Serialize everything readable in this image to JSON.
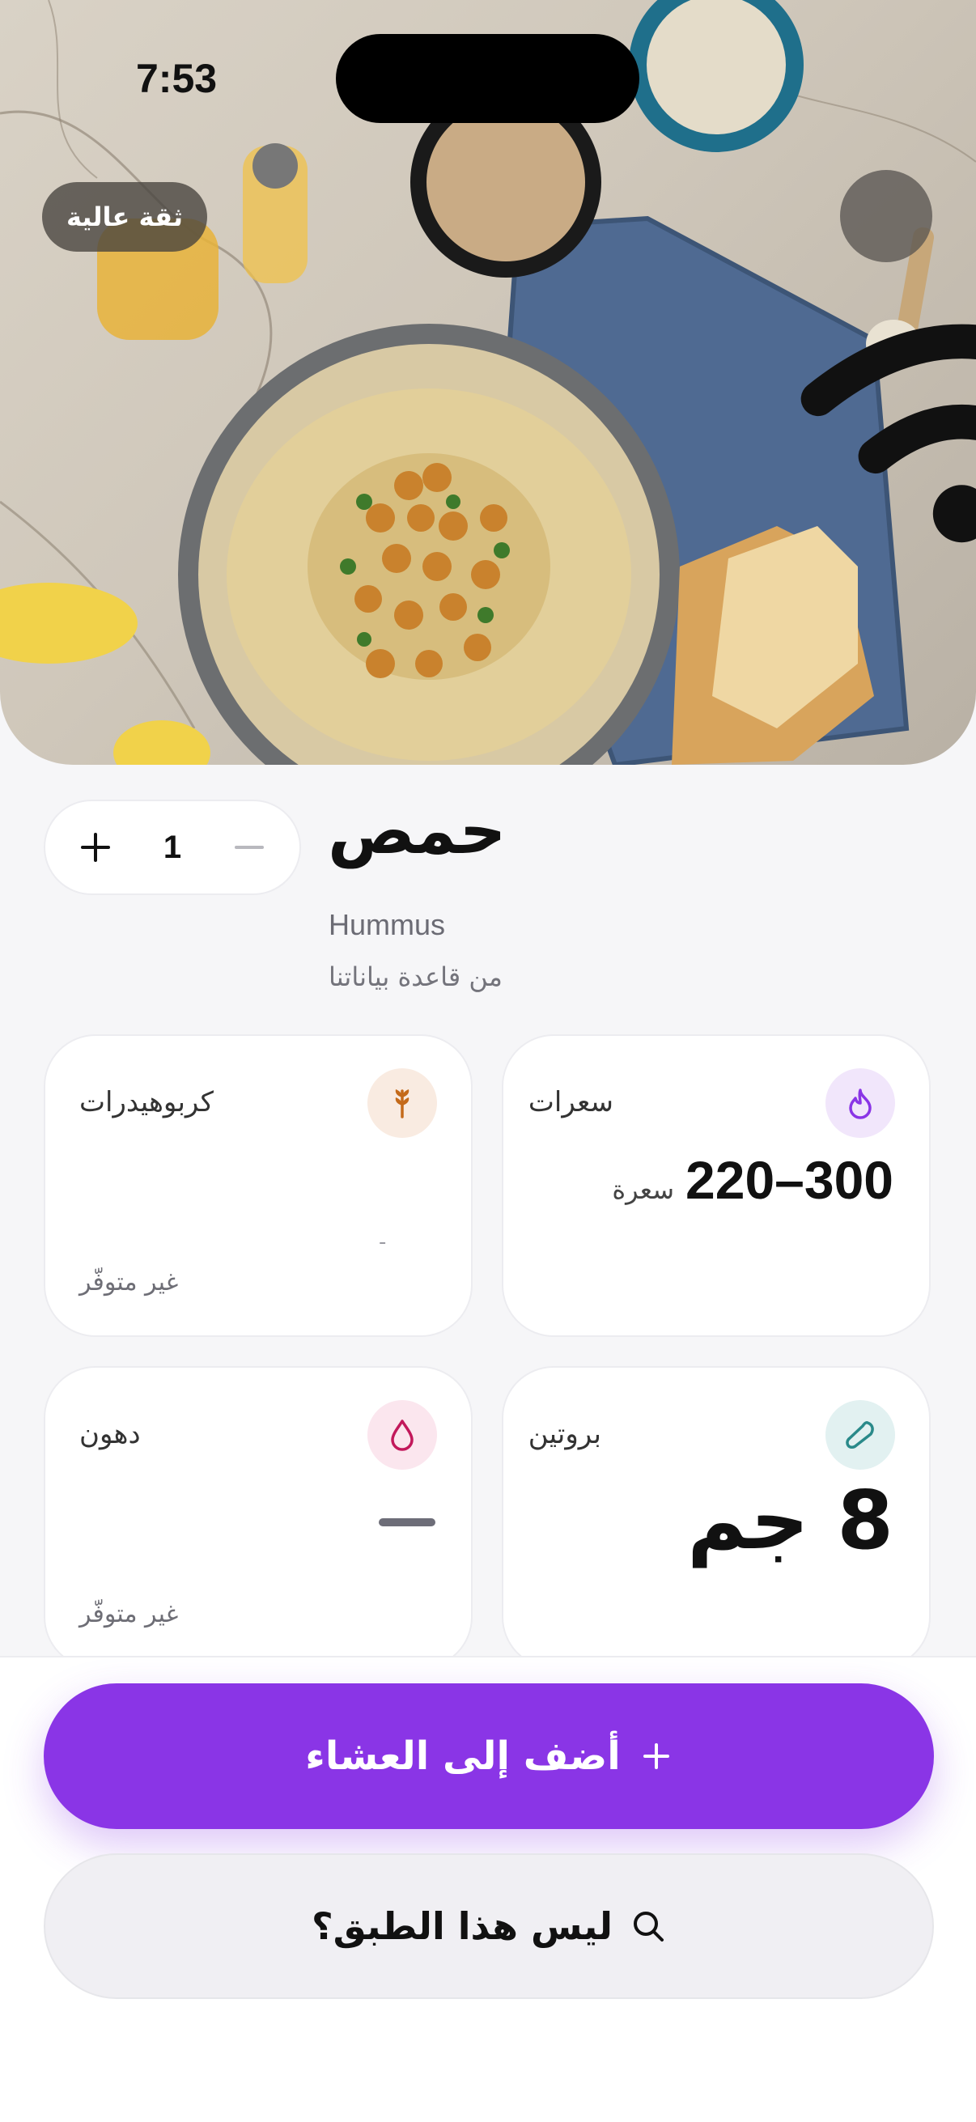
{
  "status_bar": {
    "time": "7:53"
  },
  "hero": {
    "confidence_badge": "ثقة عالية"
  },
  "dish": {
    "quantity": "1",
    "name_ar": "حمص",
    "name_en": "Hummus",
    "source": "من قاعدة بياناتنا"
  },
  "nutrition": {
    "calories": {
      "label": "سعرات",
      "value": "220–300",
      "unit": "سعرة",
      "icon": "flame-icon",
      "color": "#8a35e6"
    },
    "carbs": {
      "label": "كربوهيدرات",
      "dash": "-",
      "note": "غير متوفّر",
      "icon": "wheat-icon",
      "color": "#c46a1a"
    },
    "protein": {
      "label": "بروتين",
      "value": "8 جم",
      "icon": "drumstick-icon",
      "color": "#2a8a8a"
    },
    "fat": {
      "label": "دهون",
      "note": "غير متوفّر",
      "icon": "drop-icon",
      "color": "#c2185b"
    }
  },
  "actions": {
    "primary_label": "أضف إلى العشاء",
    "secondary_label": "ليس هذا الطبق؟"
  },
  "colors": {
    "accent": "#8a35e6"
  }
}
